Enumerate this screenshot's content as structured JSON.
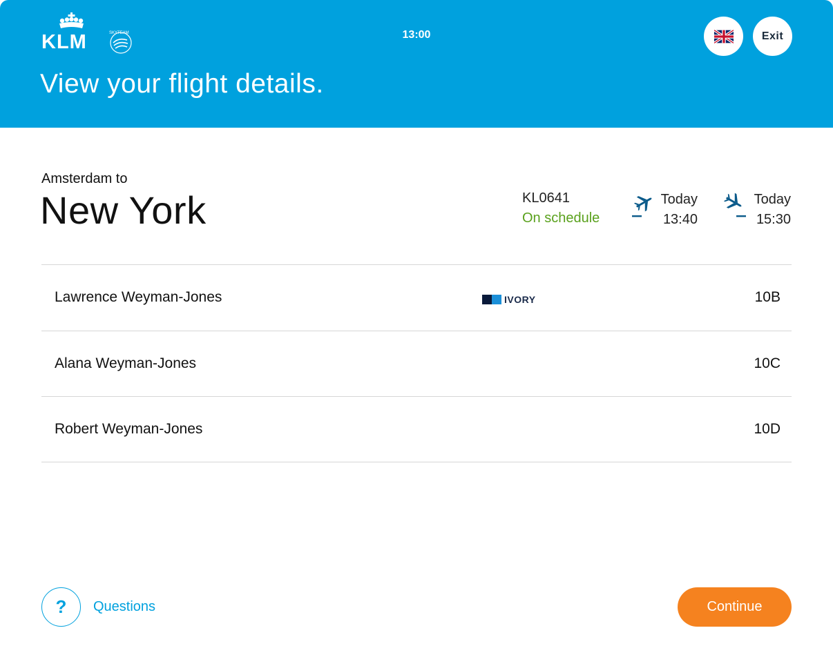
{
  "header": {
    "clock": "13:00",
    "title": "View your flight details.",
    "brand": "KLM",
    "alliance": "SKYTEAM",
    "exit_label": "Exit",
    "language_icon": "uk-flag-icon",
    "bg_color": "#00a1de"
  },
  "route": {
    "from_label": "Amsterdam to",
    "to_city": "New York"
  },
  "flight": {
    "number": "KL0641",
    "status": "On schedule",
    "status_color": "#5aa11d",
    "departure": {
      "day": "Today",
      "time": "13:40",
      "icon": "departure-plane-icon"
    },
    "arrival": {
      "day": "Today",
      "time": "15:30",
      "icon": "arrival-plane-icon"
    }
  },
  "passengers": [
    {
      "name": "Lawrence Weyman-Jones",
      "tier": "IVORY",
      "seat": "10B"
    },
    {
      "name": "Alana Weyman-Jones",
      "tier": "",
      "seat": "10C"
    },
    {
      "name": "Robert Weyman-Jones",
      "tier": "",
      "seat": "10D"
    }
  ],
  "footer": {
    "help_symbol": "?",
    "help_label": "Questions",
    "continue_label": "Continue",
    "continue_color": "#f5821f",
    "accent_color": "#00a1de"
  }
}
